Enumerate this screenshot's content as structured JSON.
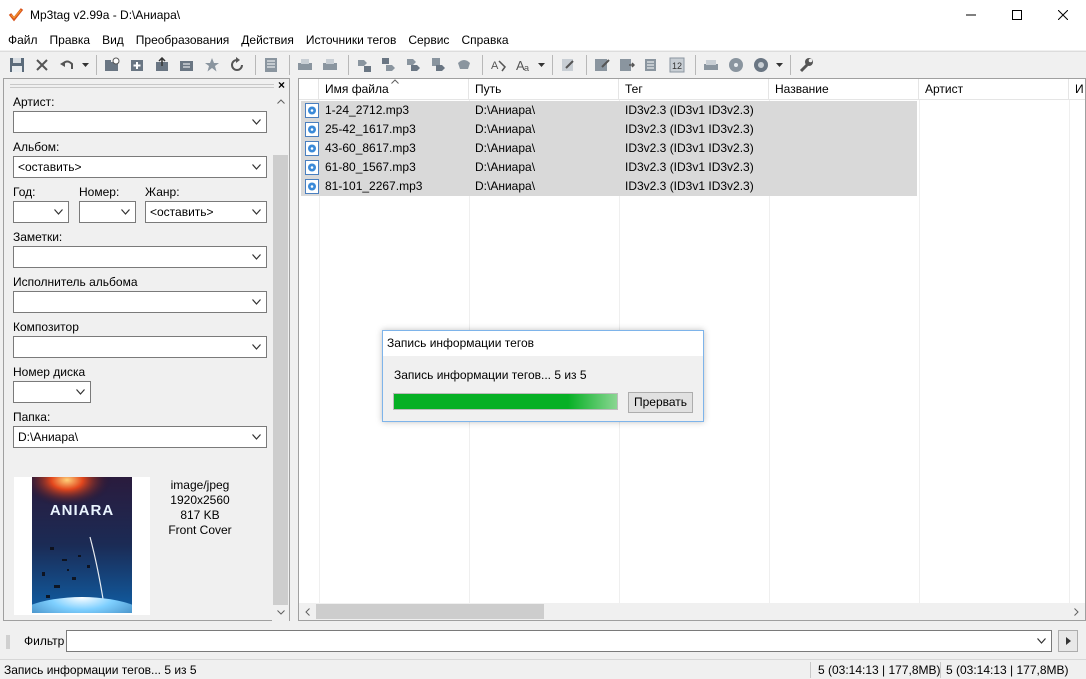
{
  "window": {
    "title": "Mp3tag v2.99a  -  D:\\Аниара\\",
    "buttons": {
      "minimize": "—",
      "maximize": "☐",
      "close": "✕"
    }
  },
  "menu": [
    "Файл",
    "Правка",
    "Вид",
    "Преобразования",
    "Действия",
    "Источники тегов",
    "Сервис",
    "Справка"
  ],
  "toolbar_icons": [
    "save-icon",
    "delete-icon",
    "undo-icon",
    "add-folder-icon",
    "add-file-icon",
    "export-icon",
    "playlist-icon",
    "favorite-icon",
    "refresh-icon",
    "list-icon",
    "print-icon",
    "print-preview-icon",
    "tag-to-filename-icon",
    "filename-to-tag-icon",
    "tag-to-tag-icon",
    "text-to-tag-icon",
    "convert-icon",
    "actions-icon",
    "case-icon",
    "edit-icon",
    "tag-sources-icon",
    "export-list-icon",
    "playlist-create-icon",
    "autonumber-icon",
    "web-sources-icon",
    "freedb-icon",
    "discogs-icon",
    "settings-icon"
  ],
  "left_panel": {
    "fields": {
      "artist_label": "Артист:",
      "artist_value": "",
      "album_label": "Альбом:",
      "album_value": "<оставить>",
      "year_label": "Год:",
      "year_value": "",
      "track_label": "Номер:",
      "track_value": "",
      "genre_label": "Жанр:",
      "genre_value": "<оставить>",
      "comment_label": "Заметки:",
      "comment_value": "",
      "album_artist_label": "Исполнитель альбома",
      "album_artist_value": "",
      "composer_label": "Композитор",
      "composer_value": "",
      "disc_label": "Номер диска",
      "disc_value": "",
      "folder_label": "Папка:",
      "folder_value": "D:\\Аниара\\"
    },
    "cover": {
      "image_text": "ANIARA",
      "mime": "image/jpeg",
      "dimensions": "1920x2560",
      "size": "817 KB",
      "type": "Front Cover"
    }
  },
  "file_list": {
    "columns": [
      "Имя файла",
      "Путь",
      "Тег",
      "Название",
      "Артист",
      "И"
    ],
    "rows": [
      {
        "filename": "1-24_2712.mp3",
        "path": "D:\\Аниара\\",
        "tag": "ID3v2.3 (ID3v1 ID3v2.3)"
      },
      {
        "filename": "25-42_1617.mp3",
        "path": "D:\\Аниара\\",
        "tag": "ID3v2.3 (ID3v1 ID3v2.3)"
      },
      {
        "filename": "43-60_8617.mp3",
        "path": "D:\\Аниара\\",
        "tag": "ID3v2.3 (ID3v1 ID3v2.3)"
      },
      {
        "filename": "61-80_1567.mp3",
        "path": "D:\\Аниара\\",
        "tag": "ID3v2.3 (ID3v1 ID3v2.3)"
      },
      {
        "filename": "81-101_2267.mp3",
        "path": "D:\\Аниара\\",
        "tag": "ID3v2.3 (ID3v1 ID3v2.3)"
      }
    ]
  },
  "filter": {
    "label": "Фильтр",
    "value": ""
  },
  "status": {
    "left": "Запись информации тегов... 5 из 5",
    "selected": "5 (03:14:13 | 177,8MB)",
    "total": "5 (03:14:13 | 177,8MB)"
  },
  "dialog": {
    "title": "Запись информации тегов",
    "message": "Запись информации тегов... 5 из 5",
    "progress": 1.0,
    "cancel_label": "Прервать"
  },
  "colors": {
    "progress": "#06b025",
    "selection": "#d9d9d9",
    "dialog_border": "#7eb4ea"
  }
}
